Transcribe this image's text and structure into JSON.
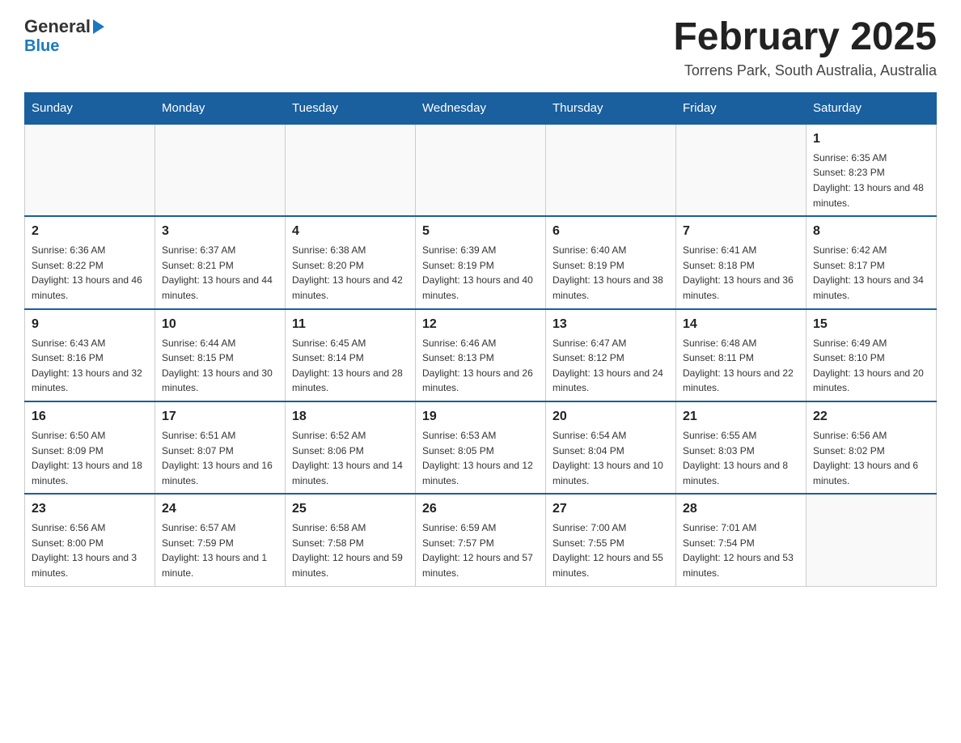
{
  "header": {
    "title": "February 2025",
    "subtitle": "Torrens Park, South Australia, Australia",
    "logo_general": "General",
    "logo_blue": "Blue"
  },
  "days_of_week": [
    "Sunday",
    "Monday",
    "Tuesday",
    "Wednesday",
    "Thursday",
    "Friday",
    "Saturday"
  ],
  "weeks": [
    [
      {
        "day": "",
        "info": ""
      },
      {
        "day": "",
        "info": ""
      },
      {
        "day": "",
        "info": ""
      },
      {
        "day": "",
        "info": ""
      },
      {
        "day": "",
        "info": ""
      },
      {
        "day": "",
        "info": ""
      },
      {
        "day": "1",
        "info": "Sunrise: 6:35 AM\nSunset: 8:23 PM\nDaylight: 13 hours and 48 minutes."
      }
    ],
    [
      {
        "day": "2",
        "info": "Sunrise: 6:36 AM\nSunset: 8:22 PM\nDaylight: 13 hours and 46 minutes."
      },
      {
        "day": "3",
        "info": "Sunrise: 6:37 AM\nSunset: 8:21 PM\nDaylight: 13 hours and 44 minutes."
      },
      {
        "day": "4",
        "info": "Sunrise: 6:38 AM\nSunset: 8:20 PM\nDaylight: 13 hours and 42 minutes."
      },
      {
        "day": "5",
        "info": "Sunrise: 6:39 AM\nSunset: 8:19 PM\nDaylight: 13 hours and 40 minutes."
      },
      {
        "day": "6",
        "info": "Sunrise: 6:40 AM\nSunset: 8:19 PM\nDaylight: 13 hours and 38 minutes."
      },
      {
        "day": "7",
        "info": "Sunrise: 6:41 AM\nSunset: 8:18 PM\nDaylight: 13 hours and 36 minutes."
      },
      {
        "day": "8",
        "info": "Sunrise: 6:42 AM\nSunset: 8:17 PM\nDaylight: 13 hours and 34 minutes."
      }
    ],
    [
      {
        "day": "9",
        "info": "Sunrise: 6:43 AM\nSunset: 8:16 PM\nDaylight: 13 hours and 32 minutes."
      },
      {
        "day": "10",
        "info": "Sunrise: 6:44 AM\nSunset: 8:15 PM\nDaylight: 13 hours and 30 minutes."
      },
      {
        "day": "11",
        "info": "Sunrise: 6:45 AM\nSunset: 8:14 PM\nDaylight: 13 hours and 28 minutes."
      },
      {
        "day": "12",
        "info": "Sunrise: 6:46 AM\nSunset: 8:13 PM\nDaylight: 13 hours and 26 minutes."
      },
      {
        "day": "13",
        "info": "Sunrise: 6:47 AM\nSunset: 8:12 PM\nDaylight: 13 hours and 24 minutes."
      },
      {
        "day": "14",
        "info": "Sunrise: 6:48 AM\nSunset: 8:11 PM\nDaylight: 13 hours and 22 minutes."
      },
      {
        "day": "15",
        "info": "Sunrise: 6:49 AM\nSunset: 8:10 PM\nDaylight: 13 hours and 20 minutes."
      }
    ],
    [
      {
        "day": "16",
        "info": "Sunrise: 6:50 AM\nSunset: 8:09 PM\nDaylight: 13 hours and 18 minutes."
      },
      {
        "day": "17",
        "info": "Sunrise: 6:51 AM\nSunset: 8:07 PM\nDaylight: 13 hours and 16 minutes."
      },
      {
        "day": "18",
        "info": "Sunrise: 6:52 AM\nSunset: 8:06 PM\nDaylight: 13 hours and 14 minutes."
      },
      {
        "day": "19",
        "info": "Sunrise: 6:53 AM\nSunset: 8:05 PM\nDaylight: 13 hours and 12 minutes."
      },
      {
        "day": "20",
        "info": "Sunrise: 6:54 AM\nSunset: 8:04 PM\nDaylight: 13 hours and 10 minutes."
      },
      {
        "day": "21",
        "info": "Sunrise: 6:55 AM\nSunset: 8:03 PM\nDaylight: 13 hours and 8 minutes."
      },
      {
        "day": "22",
        "info": "Sunrise: 6:56 AM\nSunset: 8:02 PM\nDaylight: 13 hours and 6 minutes."
      }
    ],
    [
      {
        "day": "23",
        "info": "Sunrise: 6:56 AM\nSunset: 8:00 PM\nDaylight: 13 hours and 3 minutes."
      },
      {
        "day": "24",
        "info": "Sunrise: 6:57 AM\nSunset: 7:59 PM\nDaylight: 13 hours and 1 minute."
      },
      {
        "day": "25",
        "info": "Sunrise: 6:58 AM\nSunset: 7:58 PM\nDaylight: 12 hours and 59 minutes."
      },
      {
        "day": "26",
        "info": "Sunrise: 6:59 AM\nSunset: 7:57 PM\nDaylight: 12 hours and 57 minutes."
      },
      {
        "day": "27",
        "info": "Sunrise: 7:00 AM\nSunset: 7:55 PM\nDaylight: 12 hours and 55 minutes."
      },
      {
        "day": "28",
        "info": "Sunrise: 7:01 AM\nSunset: 7:54 PM\nDaylight: 12 hours and 53 minutes."
      },
      {
        "day": "",
        "info": ""
      }
    ]
  ]
}
